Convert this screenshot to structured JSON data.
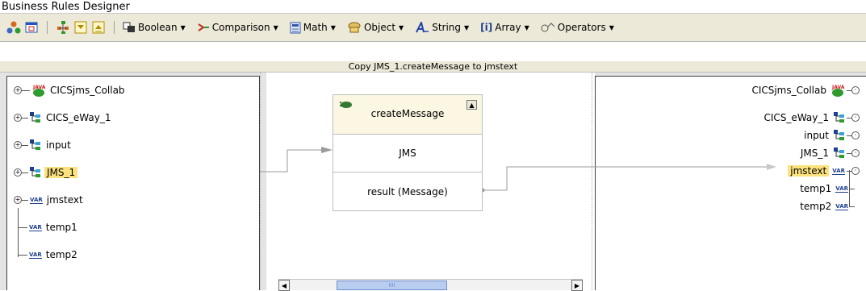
{
  "window": {
    "title": "Business Rules Designer"
  },
  "toolbar": {
    "menus": [
      {
        "label": "Boolean",
        "icon": "boolean-icon"
      },
      {
        "label": "Comparison",
        "icon": "comparison-icon"
      },
      {
        "label": "Math",
        "icon": "math-icon"
      },
      {
        "label": "Object",
        "icon": "object-icon"
      },
      {
        "label": "String",
        "icon": "string-icon"
      },
      {
        "label": "Array",
        "icon": "array-icon"
      },
      {
        "label": "Operators",
        "icon": "operators-icon"
      }
    ]
  },
  "header": {
    "rule_text": "Copy JMS_1.createMessage to jmstext"
  },
  "left_tree": {
    "items": [
      {
        "label": "CICSjms_Collab",
        "type": "java"
      },
      {
        "label": "CICS_eWay_1",
        "type": "object"
      },
      {
        "label": "input",
        "type": "object"
      },
      {
        "label": "JMS_1",
        "type": "object",
        "selected": true
      },
      {
        "label": "jmstext",
        "type": "var"
      },
      {
        "label": "temp1",
        "type": "var"
      },
      {
        "label": "temp2",
        "type": "var"
      }
    ]
  },
  "method_box": {
    "title": "createMessage",
    "input_label": "JMS",
    "output_label": "result (Message)"
  },
  "right_tree": {
    "items": [
      {
        "label": "CICSjms_Collab",
        "type": "java"
      },
      {
        "label": "CICS_eWay_1",
        "type": "object"
      },
      {
        "label": "input",
        "type": "object"
      },
      {
        "label": "JMS_1",
        "type": "object"
      },
      {
        "label": "jmstext",
        "type": "var",
        "selected": true
      },
      {
        "label": "temp1",
        "type": "var"
      },
      {
        "label": "temp2",
        "type": "var"
      }
    ]
  },
  "icons": {
    "var_badge": "VAR",
    "java_badge": "JAVA",
    "array_badge": "[i]",
    "scroll_mark": "IIII"
  },
  "colors": {
    "toolbar_bg": "#ece9d8",
    "selection": "#fbe27f",
    "scroll_thumb": "#b9cdf0"
  }
}
